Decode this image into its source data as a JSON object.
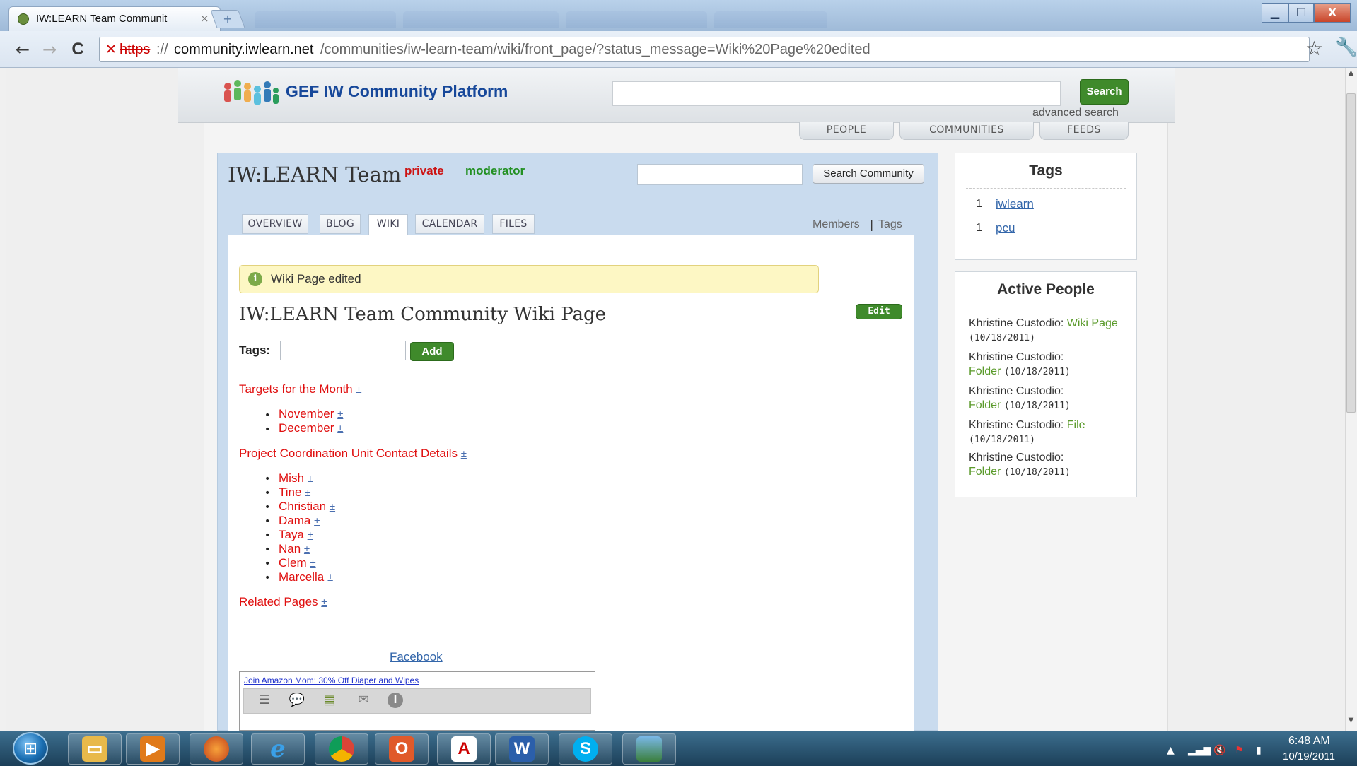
{
  "browser": {
    "tab_title": "IW:LEARN Team Communit",
    "tab_close": "×",
    "new_tab": "+",
    "url_scheme": "https",
    "url_sep": "://",
    "url_host": "community.iwlearn.net",
    "url_path": "/communities/iw-learn-team/wiki/front_page/?status_message=Wiki%20Page%20edited",
    "back_icon": "←",
    "forward_icon": "→",
    "reload_icon": "C",
    "star_icon": "☆",
    "wrench_icon": "🔧",
    "minimize": "▁",
    "maximize": "☐",
    "close": "X"
  },
  "site": {
    "title": "GEF IW Community Platform",
    "search_button": "Search",
    "advanced_search": "advanced search",
    "nav": [
      "PEOPLE",
      "COMMUNITIES",
      "FEEDS"
    ]
  },
  "community": {
    "name": "IW:LEARN Team",
    "badge_private": "private",
    "badge_moderator": "moderator",
    "search_button": "Search Community",
    "tabs": [
      "OVERVIEW",
      "BLOG",
      "WIKI",
      "CALENDAR",
      "FILES"
    ],
    "active_tab": "WIKI",
    "members_link": "Members",
    "separator": "|",
    "tags_link": "Tags"
  },
  "wiki": {
    "status_message": "Wiki Page edited",
    "status_icon": "i",
    "page_title": "IW:LEARN Team Community Wiki Page",
    "edit_button": "Edit",
    "tags_label": "Tags:",
    "add_button": "Add",
    "plus": "±",
    "bullet": "•",
    "sections": [
      {
        "heading": "Targets for the Month",
        "items": [
          "November",
          "December"
        ]
      },
      {
        "heading": "Project Coordination Unit Contact Details",
        "items": [
          "Mish",
          "Tine",
          "Christian",
          "Dama",
          "Taya",
          "Nan",
          "Clem",
          "Marcella"
        ]
      },
      {
        "heading": "Related Pages",
        "items": []
      }
    ],
    "facebook_link": "Facebook",
    "ad_link": "Join Amazon Mom: 30% Off Diaper and Wipes"
  },
  "sidebar": {
    "tags_title": "Tags",
    "tags": [
      {
        "count": "1",
        "name": "iwlearn"
      },
      {
        "count": "1",
        "name": "pcu"
      }
    ],
    "active_title": "Active People",
    "activity": [
      {
        "person": "Khristine Custodio:",
        "item": "Wiki Page",
        "date": "(10/18/2011)"
      },
      {
        "person": "Khristine Custodio:",
        "item": "Folder",
        "date": "(10/18/2011)"
      },
      {
        "person": "Khristine Custodio:",
        "item": "Folder",
        "date": "(10/18/2011)"
      },
      {
        "person": "Khristine Custodio:",
        "item": "File",
        "date": "(10/18/2011)"
      },
      {
        "person": "Khristine Custodio:",
        "item": "Folder",
        "date": "(10/18/2011)"
      }
    ]
  },
  "taskbar": {
    "time": "6:48 AM",
    "date": "10/19/2011",
    "apps": [
      "windows-explorer",
      "media-player",
      "firefox",
      "internet-explorer",
      "chrome",
      "outlook",
      "acrobat-reader",
      "word",
      "skype",
      "picture-viewer"
    ]
  }
}
